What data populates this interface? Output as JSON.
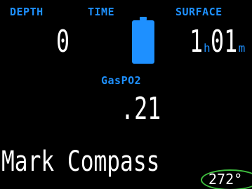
{
  "header": {
    "depth_label": "DEPTH",
    "time_label": "TIME",
    "surface_label": "SURFACE"
  },
  "values": {
    "depth": "0",
    "surface_hours": "1",
    "surface_hours_unit": "h",
    "surface_minutes": "01",
    "surface_minutes_unit": "m"
  },
  "gas": {
    "label": "GasPO2",
    "value": ".21"
  },
  "tank_indicator": {
    "icon": "gas-tank-icon",
    "color": "#1e90ff"
  },
  "action": {
    "label": "Mark Compass"
  },
  "compass": {
    "heading": "272°",
    "highlight_color": "#3fbf3f"
  },
  "colors": {
    "background": "#000000",
    "label": "#1e90ff",
    "value": "#ffffff"
  }
}
